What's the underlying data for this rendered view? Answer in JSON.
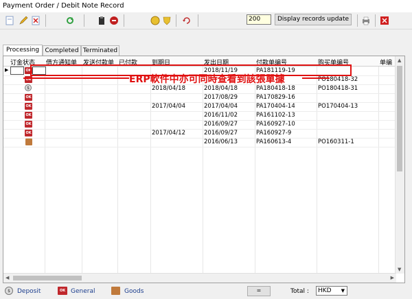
{
  "window": {
    "title": "Payment Order / Debit Note   Record"
  },
  "toolbar": {
    "records_value": "200",
    "update_label": "Display records update",
    "icons": [
      "new-icon",
      "edit-icon",
      "delete-icon",
      "refresh-icon",
      "clipboard-icon",
      "stop-icon",
      "coin-icon",
      "shield-icon",
      "rotate-icon",
      "printer-icon",
      "close-icon"
    ]
  },
  "tabs": [
    {
      "label": "Processing"
    },
    {
      "label": "Completed"
    },
    {
      "label": "Terminated"
    }
  ],
  "grid": {
    "columns": [
      "订金状态",
      "借方通知单",
      "发送付款单",
      "已付款",
      "到期日",
      "发出日期",
      "付款单编号",
      "购买单编号",
      "单编"
    ],
    "rows": [
      {
        "icon": "general",
        "due": "",
        "issued": "2018/11/19",
        "payment_no": "PA181119-19",
        "purchase_no": ""
      },
      {
        "icon": "general",
        "due": "",
        "issued": "",
        "payment_no": "",
        "purchase_no": "PO180418-32"
      },
      {
        "icon": "deposit",
        "due": "2018/04/18",
        "issued": "2018/04/18",
        "payment_no": "PA180418-18",
        "purchase_no": "PO180418-31"
      },
      {
        "icon": "general",
        "due": "",
        "issued": "2017/08/29",
        "payment_no": "PA170829-16",
        "purchase_no": ""
      },
      {
        "icon": "general",
        "due": "2017/04/04",
        "issued": "2017/04/04",
        "payment_no": "PA170404-14",
        "purchase_no": "PO170404-13"
      },
      {
        "icon": "general",
        "due": "",
        "issued": "2016/11/02",
        "payment_no": "PA161102-13",
        "purchase_no": ""
      },
      {
        "icon": "general",
        "due": "",
        "issued": "2016/09/27",
        "payment_no": "PA160927-10",
        "purchase_no": ""
      },
      {
        "icon": "general",
        "due": "2017/04/12",
        "issued": "2016/09/27",
        "payment_no": "PA160927-9",
        "purchase_no": ""
      },
      {
        "icon": "goods",
        "due": "",
        "issued": "2016/06/13",
        "payment_no": "PA160613-4",
        "purchase_no": "PO160311-1"
      }
    ]
  },
  "annotation": {
    "text": "ERP軟件中亦可同時查看到該張單據"
  },
  "footer": {
    "deposit_label": "Deposit",
    "general_label": "General",
    "goods_label": "Goods",
    "eq_label": "=",
    "total_label": "Total :",
    "currency": "HKD"
  },
  "colors": {
    "annotation": "#e01010",
    "general_icon": "#c0282d",
    "goods_icon": "#c07a3c",
    "footer_text": "#1a3c8c"
  }
}
